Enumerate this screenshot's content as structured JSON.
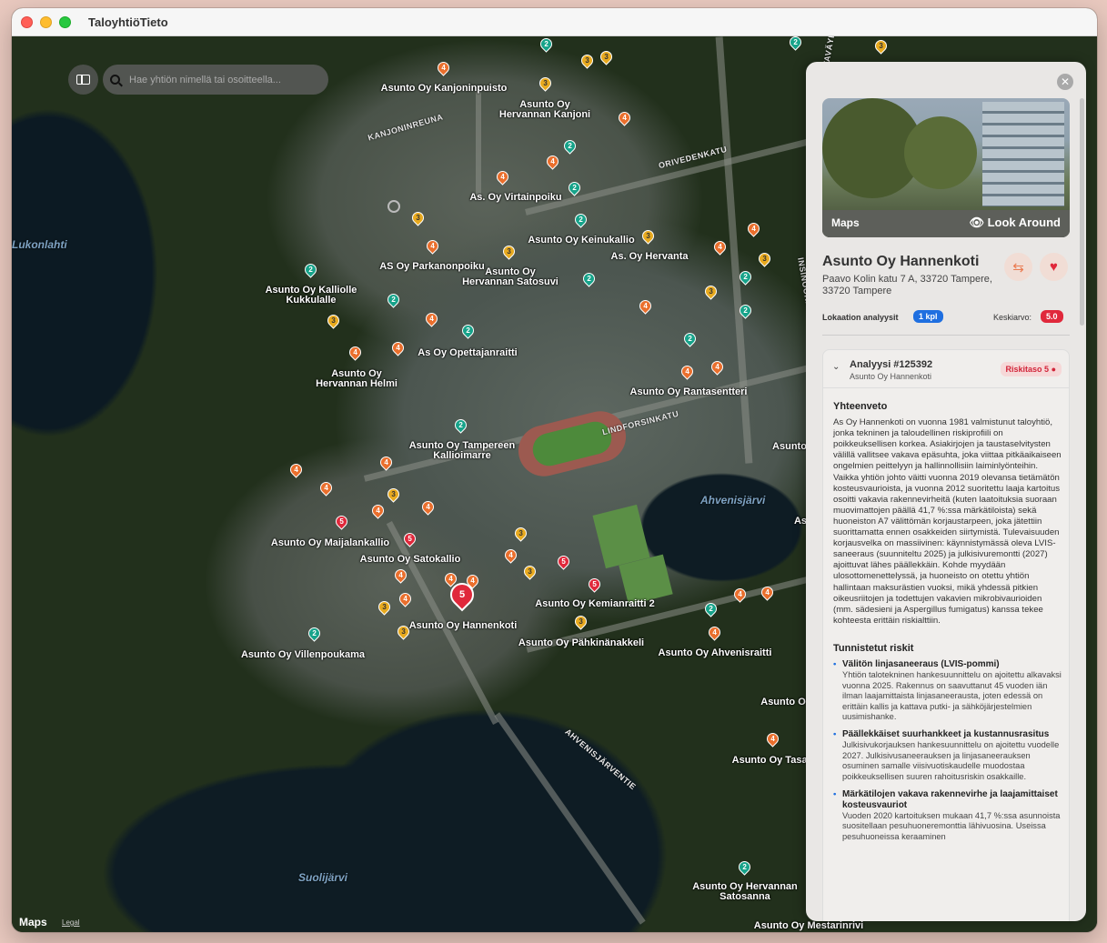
{
  "app": {
    "title": "TaloyhtiöTieto"
  },
  "search": {
    "placeholder": "Hae yhtiön nimellä tai osoitteella..."
  },
  "map": {
    "attribution": "Maps",
    "legal": "Legal",
    "streets": [
      "KANJONINREUNA",
      "ORIVEDENKATU",
      "LINDFORSINKATU",
      "AHVENISJÄRVENTIE",
      "INSINÖÖRINKATU",
      "HALTIATALANTIE",
      "HERVANNANVALTAVÄYLÄ"
    ],
    "water": [
      "Lukonlahti",
      "Ahvenisjärvi",
      "Suolijärvi"
    ],
    "labels": [
      "Asunto Oy Kanjoninpuisto",
      "Asunto Oy Hervannan Kanjoni",
      "As. Oy Virtainpoiku",
      "Asunto Oy Keinukallio",
      "AS Oy Parkanonpoiku",
      "As. Oy Hervanta",
      "Asunto Oy Hervannan Satosuvi",
      "Asunto Oy Kalliolle Kukkulalle",
      "As Oy Opettajanraitti",
      "Asunto Oy Hervannan Helmi",
      "Asunto Oy Rantasentteri",
      "Asunto Oy Tampereen Kallioimarre",
      "Asunto Oy Maijalankallio",
      "Asunto Oy Satokallio",
      "Asunto Oy Hannenkoti",
      "Asunto Oy Kemianraitti 2",
      "Asunto Oy Villenpoukama",
      "Asunto Oy Pähkinänakkeli",
      "Asunto Oy Ahvenisraitti",
      "Asunto Oy Tasata",
      "Asunto Oy Hervannan Satosanna",
      "Asunto Oy Mestarinrivi",
      "Asunto",
      "As",
      "Asunto O"
    ]
  },
  "panel": {
    "look_around": {
      "brand": "Maps",
      "button": "Look Around"
    },
    "title": "Asunto Oy Hannenkoti",
    "address": "Paavo Kolin katu 7 A, 33720 Tampere, 33720 Tampere",
    "location_label": "Lokaation analyysit",
    "location_count": "1 kpl",
    "average_label": "Keskiarvo:",
    "average_value": "5.0",
    "analysis": {
      "title": "Analyysi #125392",
      "subtitle": "Asunto Oy Hannenkoti",
      "risk_badge": "Riskitaso 5",
      "summary_heading": "Yhteenveto",
      "summary": "As Oy Hannenkoti on vuonna 1981 valmistunut taloyhtiö, jonka tekninen ja taloudellinen riskiprofiili on poikkeuksellisen korkea. Asiakirjojen ja taustaselvitysten välillä vallitsee vakava epäsuhta, joka viittaa pitkäaikaiseen ongelmien peittelyyn ja hallinnollisiin laiminlyönteihin. Vaikka yhtiön johto väitti vuonna 2019 olevansa tietämätön kosteusvaurioista, ja vuonna 2012 suoritettu laaja kartoitus osoitti vakavia rakennevirheitä (kuten laatoituksia suoraan muovimattojen päällä 41,7 %:ssa märkätiloista) sekä huoneiston A7 välittömän korjaustarpeen, joka jätettiin suorittamatta ennen osakkeiden siirtymistä. Tulevaisuuden korjausvelka on massiivinen: käynnistymässä oleva LVIS-saneeraus (suunniteltu 2025) ja julkisivuremontti (2027) ajoittuvat lähes päällekkäin. Kohde myydään ulosottomenettelyssä, ja huoneisto on otettu yhtiön hallintaan maksurästien vuoksi, mikä yhdessä pitkien oikeusriitojen ja todettujen vakavien mikrobivaurioiden (mm. sädesieni ja Aspergillus fumigatus) kanssa tekee kohteesta erittäin riskialttiin.",
      "risks_heading": "Tunnistetut riskit",
      "risks": [
        {
          "title": "Välitön linjasaneeraus (LVIS-pommi)",
          "text": "Yhtiön talotekninen hankesuunnittelu on ajoitettu alkavaksi vuonna 2025. Rakennus on saavuttanut 45 vuoden iän ilman laajamittaista linjasaneerausta, joten edessä on erittäin kallis ja kattava putki- ja sähköjärjestelmien uusimishanke."
        },
        {
          "title": "Päällekkäiset suurhankkeet ja kustannusrasitus",
          "text": "Julkisivukorjauksen hankesuunnittelu on ajoitettu vuodelle 2027. Julkisivusaneerauksen ja linjasaneerauksen osuminen samalle viisivuotiskaudelle muodostaa poikkeuksellisen suuren rahoitusriskin osakkaille."
        },
        {
          "title": "Märkätilojen vakava rakennevirhe ja laajamittaiset kosteusvauriot",
          "text": "Vuoden 2020 kartoituksen mukaan 41,7 %:ssa asunnoista suositellaan pesuhuoneremonttia lähivuosina. Useissa pesuhuoneissa keraaminen"
        }
      ]
    }
  },
  "colors": {
    "risk2": "#17a38a",
    "risk3": "#e8aa1f",
    "risk4": "#ea6f2d",
    "risk5": "#e0283b",
    "accent": "#1f6fe0"
  }
}
